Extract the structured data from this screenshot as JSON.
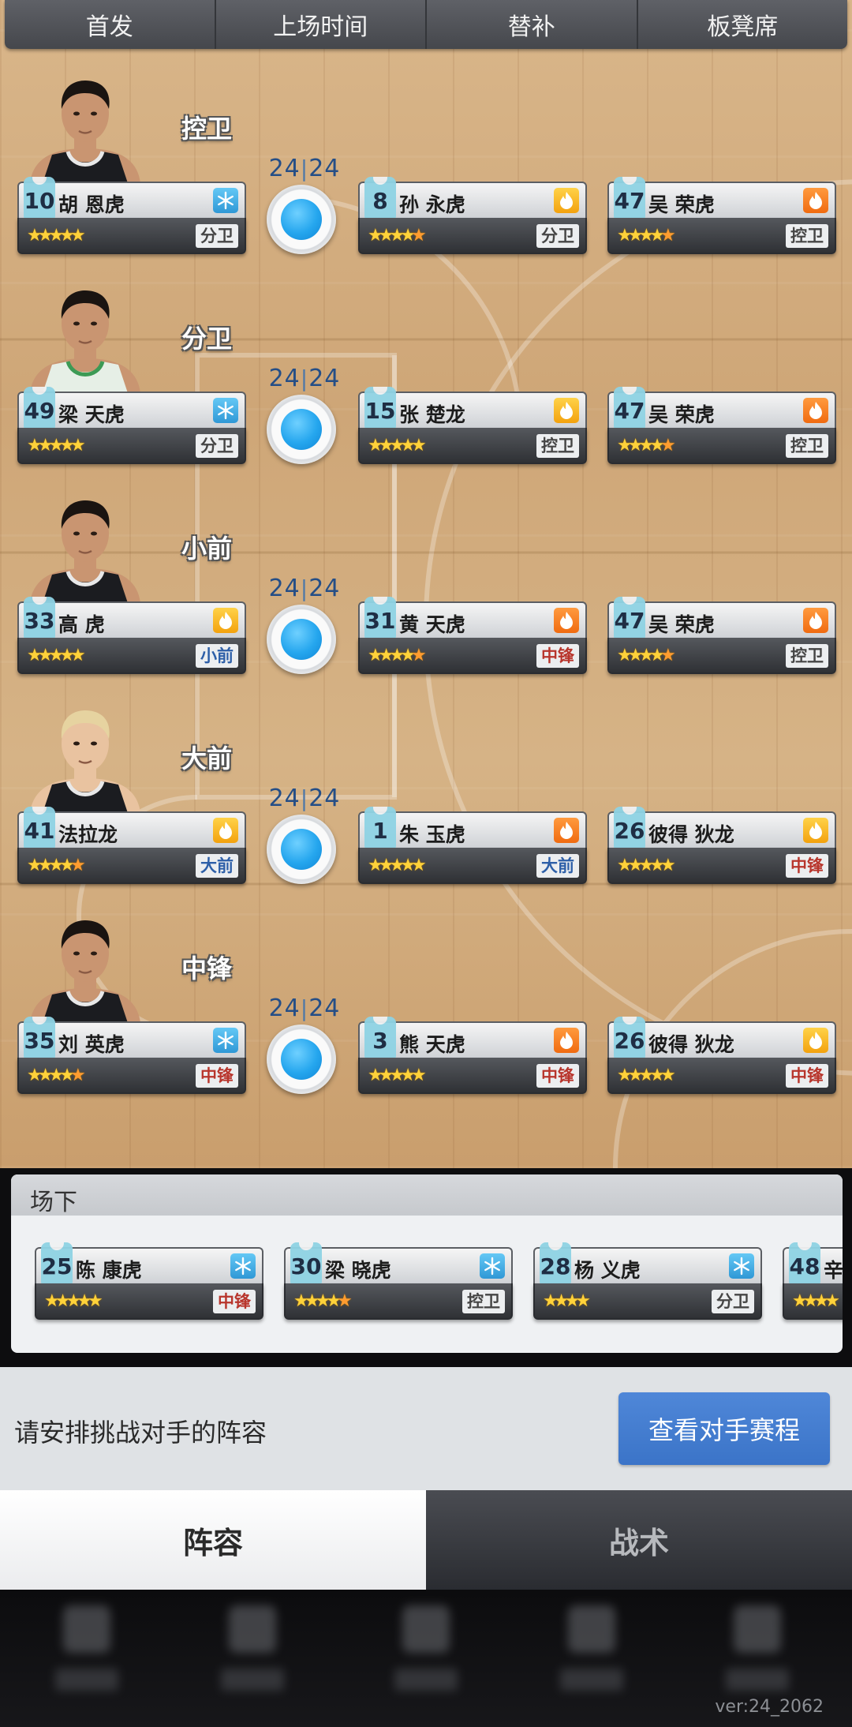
{
  "top_tabs": [
    "首发",
    "上场时间",
    "替补",
    "板凳席"
  ],
  "rows": [
    {
      "position": "控卫",
      "counter": {
        "a": "24",
        "b": "24"
      },
      "portrait": "player-dark-jersey",
      "starter": {
        "num": "10",
        "name": "胡 恩虎",
        "form": "snowflake",
        "pos": "分卫",
        "stars": 5
      },
      "subs": [
        {
          "num": "8",
          "name": "孙 永虎",
          "form": "flame-yellow",
          "pos": "分卫",
          "stars": 4.5
        },
        {
          "num": "47",
          "name": "吴 荣虎",
          "form": "flame-orange",
          "pos": "控卫",
          "stars": 4.5
        }
      ]
    },
    {
      "position": "分卫",
      "counter": {
        "a": "24",
        "b": "24"
      },
      "portrait": "player-green-jersey",
      "starter": {
        "num": "49",
        "name": "梁 天虎",
        "form": "snowflake",
        "pos": "分卫",
        "stars": 5
      },
      "subs": [
        {
          "num": "15",
          "name": "张 楚龙",
          "form": "flame-yellow",
          "pos": "控卫",
          "stars": 5
        },
        {
          "num": "47",
          "name": "吴 荣虎",
          "form": "flame-orange",
          "pos": "控卫",
          "stars": 4.5
        }
      ]
    },
    {
      "position": "小前",
      "counter": {
        "a": "24",
        "b": "24"
      },
      "portrait": "player-dark-jersey",
      "starter": {
        "num": "33",
        "name": "高 虎",
        "form": "flame-yellow",
        "pos": "小前",
        "stars": 5
      },
      "subs": [
        {
          "num": "31",
          "name": "黄 天虎",
          "form": "flame-orange",
          "pos": "中锋",
          "stars": 4.5
        },
        {
          "num": "47",
          "name": "吴 荣虎",
          "form": "flame-orange",
          "pos": "控卫",
          "stars": 4.5
        }
      ]
    },
    {
      "position": "大前",
      "counter": {
        "a": "24",
        "b": "24"
      },
      "portrait": "player-blonde",
      "starter": {
        "num": "41",
        "name": "法拉龙",
        "form": "flame-yellow",
        "pos": "大前",
        "stars": 4.5
      },
      "subs": [
        {
          "num": "1",
          "name": "朱 玉虎",
          "form": "flame-orange",
          "pos": "大前",
          "stars": 5
        },
        {
          "num": "26",
          "name": "彼得 狄龙",
          "form": "flame-yellow",
          "pos": "中锋",
          "stars": 5
        }
      ]
    },
    {
      "position": "中锋",
      "counter": {
        "a": "24",
        "b": "24"
      },
      "portrait": "player-dark-jersey",
      "starter": {
        "num": "35",
        "name": "刘 英虎",
        "form": "snowflake",
        "pos": "中锋",
        "stars": 4.5
      },
      "subs": [
        {
          "num": "3",
          "name": "熊 天虎",
          "form": "flame-orange",
          "pos": "中锋",
          "stars": 5
        },
        {
          "num": "26",
          "name": "彼得 狄龙",
          "form": "flame-yellow",
          "pos": "中锋",
          "stars": 5
        }
      ]
    }
  ],
  "bench": {
    "title": "场下",
    "players": [
      {
        "num": "25",
        "name": "陈 康虎",
        "form": "snowflake-alt",
        "pos": "中锋",
        "stars": 5
      },
      {
        "num": "30",
        "name": "梁 晓虎",
        "form": "snowflake-alt",
        "pos": "控卫",
        "stars": 4.5
      },
      {
        "num": "28",
        "name": "杨 义虎",
        "form": "snowflake-alt",
        "pos": "分卫",
        "stars": 4
      },
      {
        "num": "48",
        "name": "辛",
        "form": "snowflake-alt",
        "pos": "",
        "stars": 4
      }
    ]
  },
  "prompt": {
    "text": "请安排挑战对手的阵容",
    "button": "查看对手赛程"
  },
  "bottom_tabs": {
    "active": "阵容",
    "inactive": "战术"
  },
  "version": "ver:24_2062",
  "colors": {
    "accent_blue": "#3b74c8",
    "court": "#d2ad7e",
    "pos_red": "#b8352c",
    "pos_blue": "#2d5fa8"
  }
}
